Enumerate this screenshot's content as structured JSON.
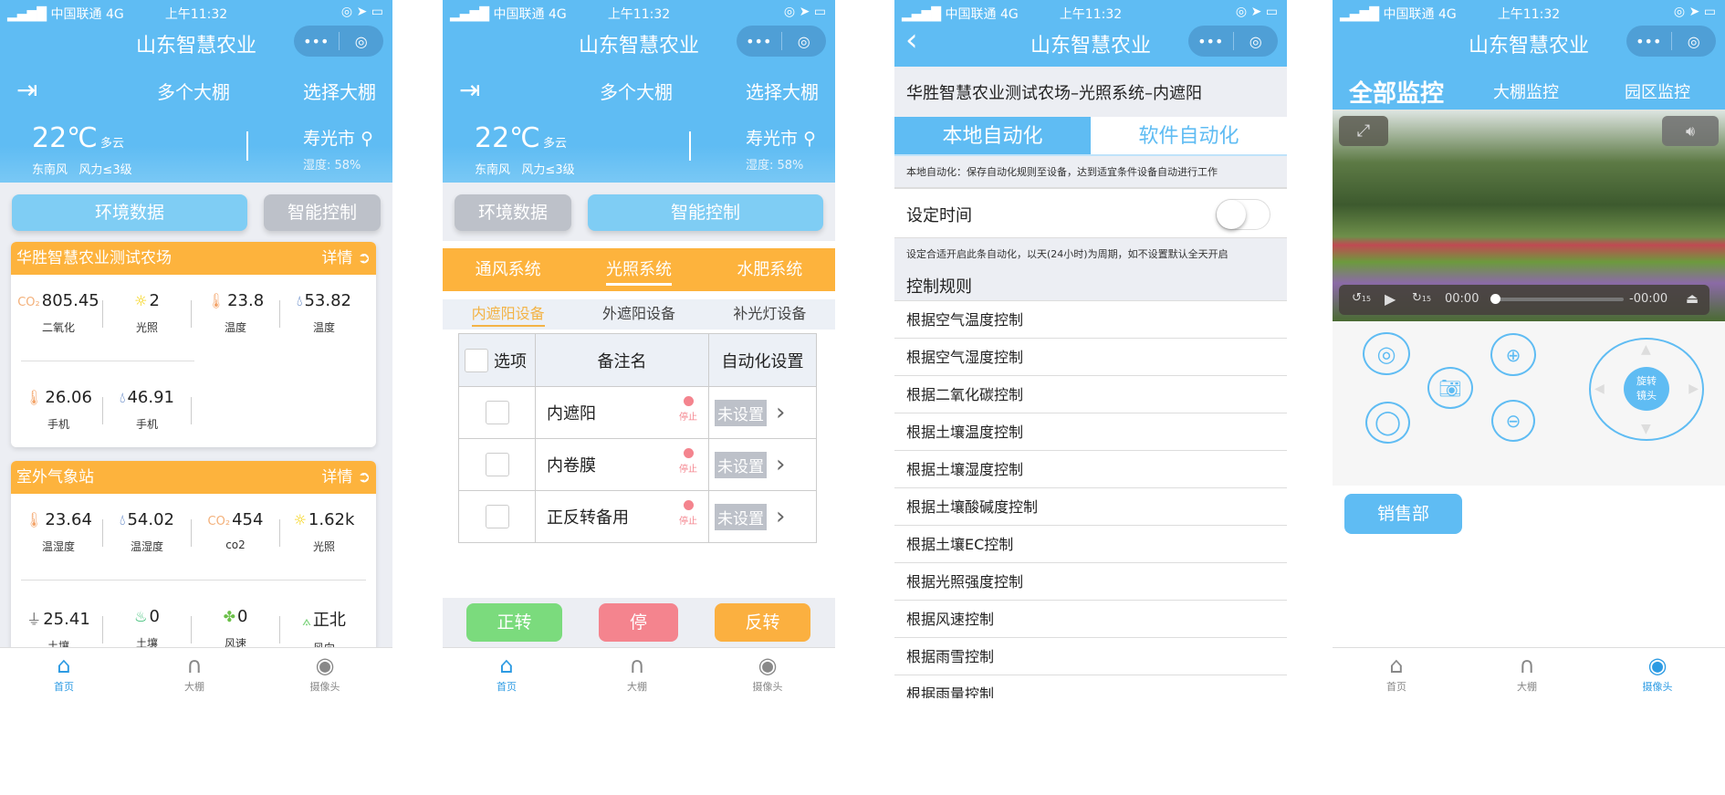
{
  "status": {
    "carrier": "中国联通",
    "network": "4G",
    "time": "上午11:32"
  },
  "app_title": "山东智慧农业",
  "capsule": {
    "more": "•••",
    "close": "◎"
  },
  "home": {
    "nav_center": "多个大棚",
    "nav_right": "选择大棚",
    "weather": {
      "temp": "22℃",
      "cond": "多云",
      "wind": "东南风",
      "force": "风力≤3级",
      "city": "寿光市",
      "humidity": "湿度: 58%"
    },
    "btn_env": "环境数据",
    "btn_ctrl": "智能控制",
    "card1": {
      "title": "华胜智慧农业测试农场",
      "detail": "详情",
      "items": [
        {
          "icon": "co2-icon",
          "v": "805.45",
          "k": "二氧化"
        },
        {
          "icon": "sun-icon",
          "v": "2",
          "k": "光照"
        },
        {
          "icon": "thermometer-icon",
          "v": "23.8",
          "k": "温度"
        },
        {
          "icon": "droplet-icon",
          "v": "53.82",
          "k": "温度"
        },
        {
          "icon": "thermometer-icon",
          "v": "26.06",
          "k": "手机"
        },
        {
          "icon": "droplet-icon",
          "v": "46.91",
          "k": "手机"
        }
      ]
    },
    "card2": {
      "title": "室外气象站",
      "detail": "详情",
      "items": [
        {
          "icon": "thermometer-icon",
          "v": "23.64",
          "k": "温湿度"
        },
        {
          "icon": "droplet-icon",
          "v": "54.02",
          "k": "温湿度"
        },
        {
          "icon": "co2-icon",
          "v": "454",
          "k": "co2"
        },
        {
          "icon": "sun-icon",
          "v": "1.62k",
          "k": "光照"
        },
        {
          "icon": "soil-temp-icon",
          "v": "25.41",
          "k": "土壤"
        },
        {
          "icon": "soil-moisture-icon",
          "v": "0",
          "k": "土壤"
        },
        {
          "icon": "fan-icon",
          "v": "0",
          "k": "风速"
        },
        {
          "icon": "wind-direction-icon",
          "v": "正北",
          "k": "风向"
        }
      ]
    }
  },
  "tabs": [
    "首页",
    "大棚",
    "摄像头"
  ],
  "control": {
    "systems": [
      "通风系统",
      "光照系统",
      "水肥系统"
    ],
    "active_system": 1,
    "subtabs": [
      "内遮阳设备",
      "外遮阳设备",
      "补光灯设备"
    ],
    "active_subtab": 0,
    "headers": [
      "选项",
      "备注名",
      "自动化设置"
    ],
    "rows": [
      {
        "name": "内遮阳",
        "state": "停止",
        "auto": "未设置"
      },
      {
        "name": "内卷膜",
        "state": "停止",
        "auto": "未设置"
      },
      {
        "name": "正反转备用",
        "state": "停止",
        "auto": "未设置"
      }
    ],
    "actions": [
      "正转",
      "停",
      "反转"
    ],
    "colors": {
      "forward": "#7bdb7d",
      "stop": "#f4848e",
      "reverse": "#fbb040",
      "orange": "#fdb33d",
      "blue": "#5fbcf3"
    }
  },
  "auto": {
    "back": "‹",
    "breadcrumb": "华胜智慧农业测试农场–光照系统–内遮阳",
    "tabs": [
      "本地自动化",
      "软件自动化"
    ],
    "desc": "本地自动化：保存自动化规则至设备，达到适宜条件设备自动进行工作",
    "set_time": "设定时间",
    "set_time_on": false,
    "hint": "设定合适开启此条自动化，以天(24小时)为周期，如不设置默认全天开启",
    "rules_title": "控制规则",
    "rules": [
      "根据空气温度控制",
      "根据空气湿度控制",
      "根据二氧化碳控制",
      "根据土壤温度控制",
      "根据土壤湿度控制",
      "根据土壤酸碱度控制",
      "根据土壤EC控制",
      "根据光照强度控制",
      "根据风速控制",
      "根据雨雪控制",
      "根据雨量控制"
    ]
  },
  "camera": {
    "tabs": [
      "全部监控",
      "大棚监控",
      "园区监控"
    ],
    "player": {
      "current": "00:00",
      "remaining": "-00:00",
      "progress": 0,
      "skip": "15"
    },
    "ptz_center": [
      "旋转",
      "镜头"
    ],
    "location_button": "销售部"
  }
}
